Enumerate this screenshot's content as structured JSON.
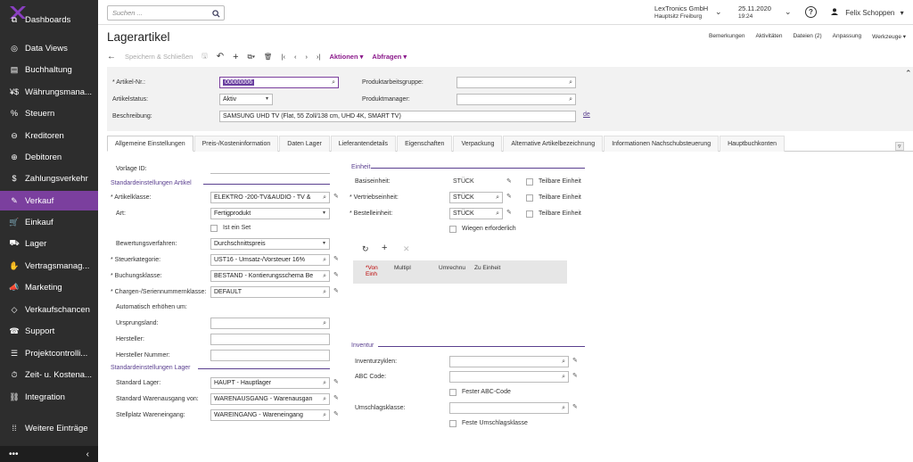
{
  "sidebar": {
    "items": [
      {
        "label": "Dashboards",
        "icon": "dashboard-icon",
        "glyph": "⧉"
      },
      {
        "label": "Data Views",
        "icon": "data-views-icon",
        "glyph": "◎"
      },
      {
        "label": "Buchhaltung",
        "icon": "book-icon",
        "glyph": "▤"
      },
      {
        "label": "Währungsmana...",
        "icon": "currency-icon",
        "glyph": "¥$"
      },
      {
        "label": "Steuern",
        "icon": "percent-icon",
        "glyph": "%"
      },
      {
        "label": "Kreditoren",
        "icon": "minus-circle-icon",
        "glyph": "⊖"
      },
      {
        "label": "Debitoren",
        "icon": "plus-circle-icon",
        "glyph": "⊕"
      },
      {
        "label": "Zahlungsverkehr",
        "icon": "dollar-icon",
        "glyph": "$"
      },
      {
        "label": "Verkauf",
        "icon": "edit-icon",
        "glyph": "✎"
      },
      {
        "label": "Einkauf",
        "icon": "cart-icon",
        "glyph": "🛒"
      },
      {
        "label": "Lager",
        "icon": "truck-icon",
        "glyph": "⛟"
      },
      {
        "label": "Vertragsmanag...",
        "icon": "handshake-icon",
        "glyph": "✋"
      },
      {
        "label": "Marketing",
        "icon": "megaphone-icon",
        "glyph": "📣"
      },
      {
        "label": "Verkaufschancen",
        "icon": "tag-icon",
        "glyph": "◇"
      },
      {
        "label": "Support",
        "icon": "support-icon",
        "glyph": "☎"
      },
      {
        "label": "Projektcontrolli...",
        "icon": "sliders-icon",
        "glyph": "☰"
      },
      {
        "label": "Zeit- u. Kostena...",
        "icon": "stopwatch-icon",
        "glyph": "⏱"
      },
      {
        "label": "Integration",
        "icon": "integration-icon",
        "glyph": "⛓"
      },
      {
        "label": "Weitere Einträge",
        "icon": "grid-icon",
        "glyph": "⁞⁞"
      }
    ],
    "bottom_dots": "•••",
    "collapse": "‹"
  },
  "topbar": {
    "search_placeholder": "Suchen ...",
    "company": "LexTronics GmbH",
    "branch": "Hauptsitz Freiburg",
    "date": "25.11.2020",
    "time": "19:24",
    "help": "?",
    "user": "Felix Schoppen"
  },
  "page": {
    "title": "Lagerartikel",
    "links": [
      "Bemerkungen",
      "Aktivitäten",
      "Dateien (2)",
      "Anpassung",
      "Werkzeuge ▾"
    ]
  },
  "toolbar": {
    "save_close": "Speichern & Schließen",
    "actions": "Aktionen ▾",
    "queries": "Abfragen ▾"
  },
  "header": {
    "artikel_nr_label": "* Artikel-Nr.:",
    "artikel_nr_value": "00000006",
    "status_label": "Artikelstatus:",
    "status_value": "Aktiv",
    "beschreibung_label": "Beschreibung:",
    "beschreibung_value": "SAMSUNG UHD TV (Flat, 55 Zoll/138 cm, UHD 4K, SMART TV)",
    "lang_link": "de",
    "arbeitsgruppe_label": "Produktarbeitsgruppe:",
    "manager_label": "Produktmanager:"
  },
  "tabs": [
    "Allgemeine Einstellungen",
    "Preis-/Kosteninformation",
    "Daten Lager",
    "Lieferantendetails",
    "Eigenschaften",
    "Verpackung",
    "Alternative Artikelbezeichnung",
    "Informationen Nachschubsteuerung",
    "Hauptbuchkonten"
  ],
  "left": {
    "vorlage_label": "Vorlage ID:",
    "sect_std_artikel": "Standardeinstellungen Artikel",
    "artikelklasse_label": "* Artikelklasse:",
    "artikelklasse_value": "ELEKTRO   -200-TV&AUDIO - TV &",
    "art_label": "Art:",
    "art_value": "Fertigprodukt",
    "ist_ein_set": "Ist ein Set",
    "bewertung_label": "Bewertungsverfahren:",
    "bewertung_value": "Durchschnittspreis",
    "steuer_label": "* Steuerkategorie:",
    "steuer_value": "UST16 - Umsatz-/Vorsteuer 16%",
    "buchung_label": "* Buchungsklasse:",
    "buchung_value": "BESTAND - Kontierungsschema Be",
    "chargen_label": "* Chargen-/Seriennummernklasse:",
    "chargen_value": "DEFAULT",
    "auto_label": "Automatisch erhöhen um:",
    "ursprung_label": "Ursprungsland:",
    "hersteller_label": "Hersteller:",
    "hersteller_nr_label": "Hersteller Nummer:",
    "sect_std_lager": "Standardeinstellungen Lager",
    "std_lager_label": "Standard Lager:",
    "std_lager_value": "HAUPT - Hauptlager",
    "std_ausgang_label": "Standard Warenausgang von:",
    "std_ausgang_value": "WARENAUSGANG - Warenausgan",
    "stellplatz_label": "Stellplatz Wareneingang:",
    "stellplatz_value": "WAREINGANG - Wareneingang"
  },
  "right": {
    "sect_einheit": "Einheit",
    "basis_label": "Basiseinheit:",
    "basis_value": "STÜCK",
    "vertrieb_label": "* Vertriebseinheit:",
    "vertrieb_value": "STÜCK",
    "bestell_label": "* Bestelleinheit:",
    "bestell_value": "STÜCK",
    "teilbare": "Teilbare Einheit",
    "wiegen": "Wiegen erforderlich",
    "grid_cols": [
      "*Von Einh",
      "Multipl",
      "Umrechnu",
      "Zu Einheit"
    ],
    "sect_inventur": "Inventur",
    "inventurzyklen_label": "Inventurzyklen:",
    "abc_label": "ABC Code:",
    "fester_abc": "Fester ABC-Code",
    "umschlag_label": "Umschlagsklasse:",
    "feste_umschlag": "Feste Umschlagsklasse"
  }
}
